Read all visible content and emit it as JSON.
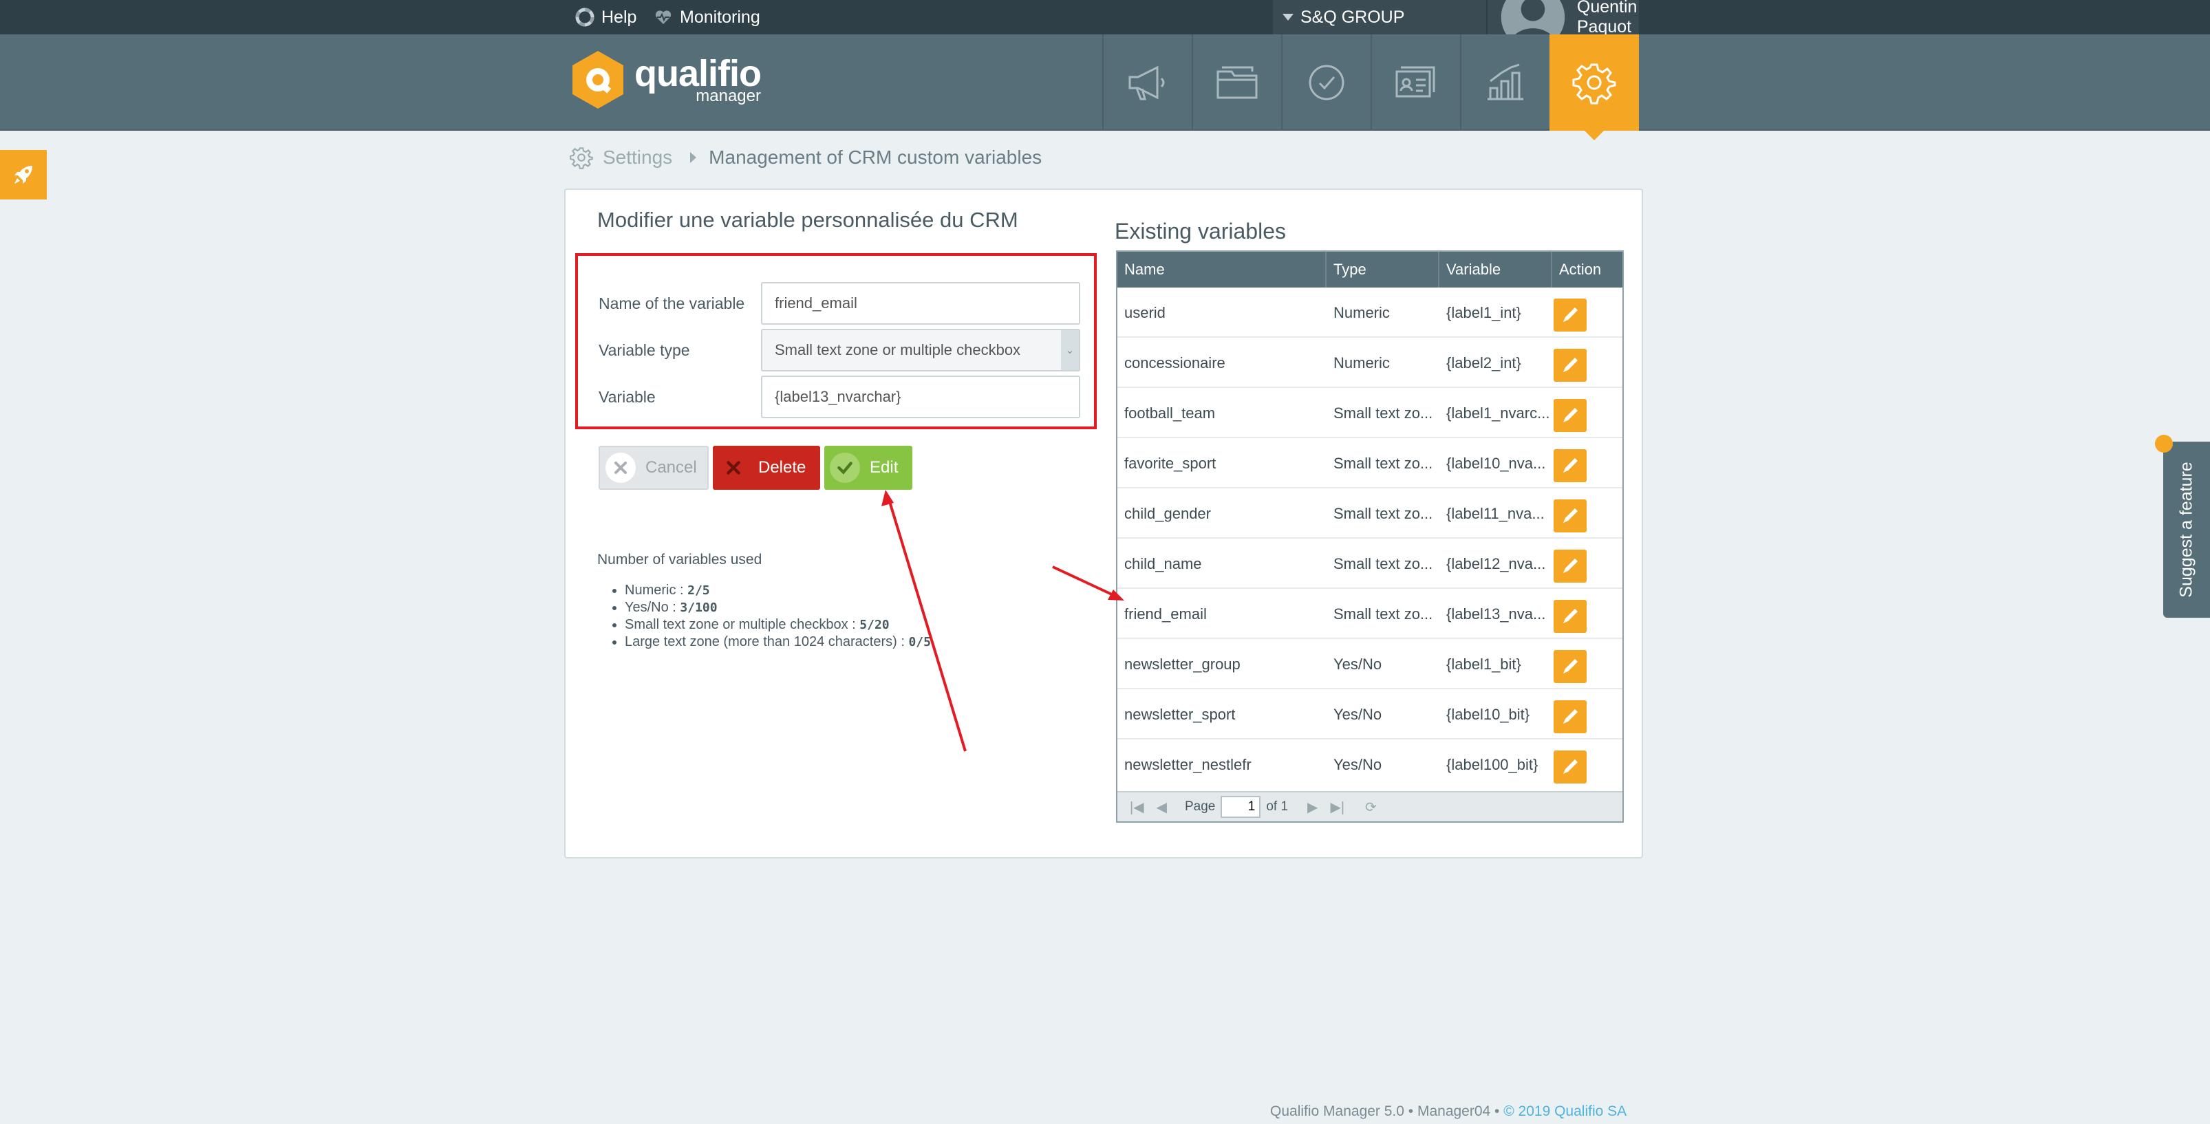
{
  "topbar": {
    "help": "Help",
    "monitoring": "Monitoring",
    "organization": "S&Q GROUP",
    "user": "Quentin Paquot"
  },
  "logo": {
    "name": "qualifio",
    "sub": "manager"
  },
  "nav": [
    "megaphone-icon",
    "folder-icon",
    "check-circle-icon",
    "contacts-icon",
    "chart-icon",
    "gear-icon"
  ],
  "breadcrumb": {
    "root": "Settings",
    "current": "Management of CRM custom variables"
  },
  "form": {
    "title": "Modifier une variable personnalisée du CRM",
    "name_label": "Name of the variable",
    "name_value": "friend_email",
    "type_label": "Variable type",
    "type_value": "Small text zone or multiple checkbox",
    "variable_label": "Variable",
    "variable_value": "{label13_nvarchar}",
    "cancel": "Cancel",
    "delete": "Delete",
    "edit": "Edit"
  },
  "stats": {
    "title": "Number of variables used",
    "items": [
      {
        "label": "Numeric : ",
        "value": "2/5"
      },
      {
        "label": "Yes/No : ",
        "value": "3/100"
      },
      {
        "label": "Small text zone or multiple checkbox : ",
        "value": "5/20"
      },
      {
        "label": "Large text zone (more than 1024 characters) : ",
        "value": "0/5"
      }
    ]
  },
  "table": {
    "title": "Existing variables",
    "headers": [
      "Name",
      "Type",
      "Variable",
      "Action"
    ],
    "rows": [
      [
        "userid",
        "Numeric",
        "{label1_int}"
      ],
      [
        "concessionaire",
        "Numeric",
        "{label2_int}"
      ],
      [
        "football_team",
        "Small text zo...",
        "{label1_nvarc..."
      ],
      [
        "favorite_sport",
        "Small text zo...",
        "{label10_nva..."
      ],
      [
        "child_gender",
        "Small text zo...",
        "{label11_nva..."
      ],
      [
        "child_name",
        "Small text zo...",
        "{label12_nva..."
      ],
      [
        "friend_email",
        "Small text zo...",
        "{label13_nva..."
      ],
      [
        "newsletter_group",
        "Yes/No",
        "{label1_bit}"
      ],
      [
        "newsletter_sport",
        "Yes/No",
        "{label10_bit}"
      ],
      [
        "newsletter_nestlefr",
        "Yes/No",
        "{label100_bit}"
      ]
    ],
    "pager": {
      "page_label": "Page",
      "page": "1",
      "of": "of 1"
    }
  },
  "suggest": "Suggest a feature",
  "footer": {
    "text": "Qualifio Manager 5.0 • Manager04 • ",
    "copyright": "© 2019 Qualifio SA"
  },
  "colors": {
    "accent": "#f5a623",
    "header": "#566e77",
    "topbar": "#2f3f47",
    "delete": "#c9271d",
    "edit": "#87c442",
    "annotation": "#e31b23"
  }
}
